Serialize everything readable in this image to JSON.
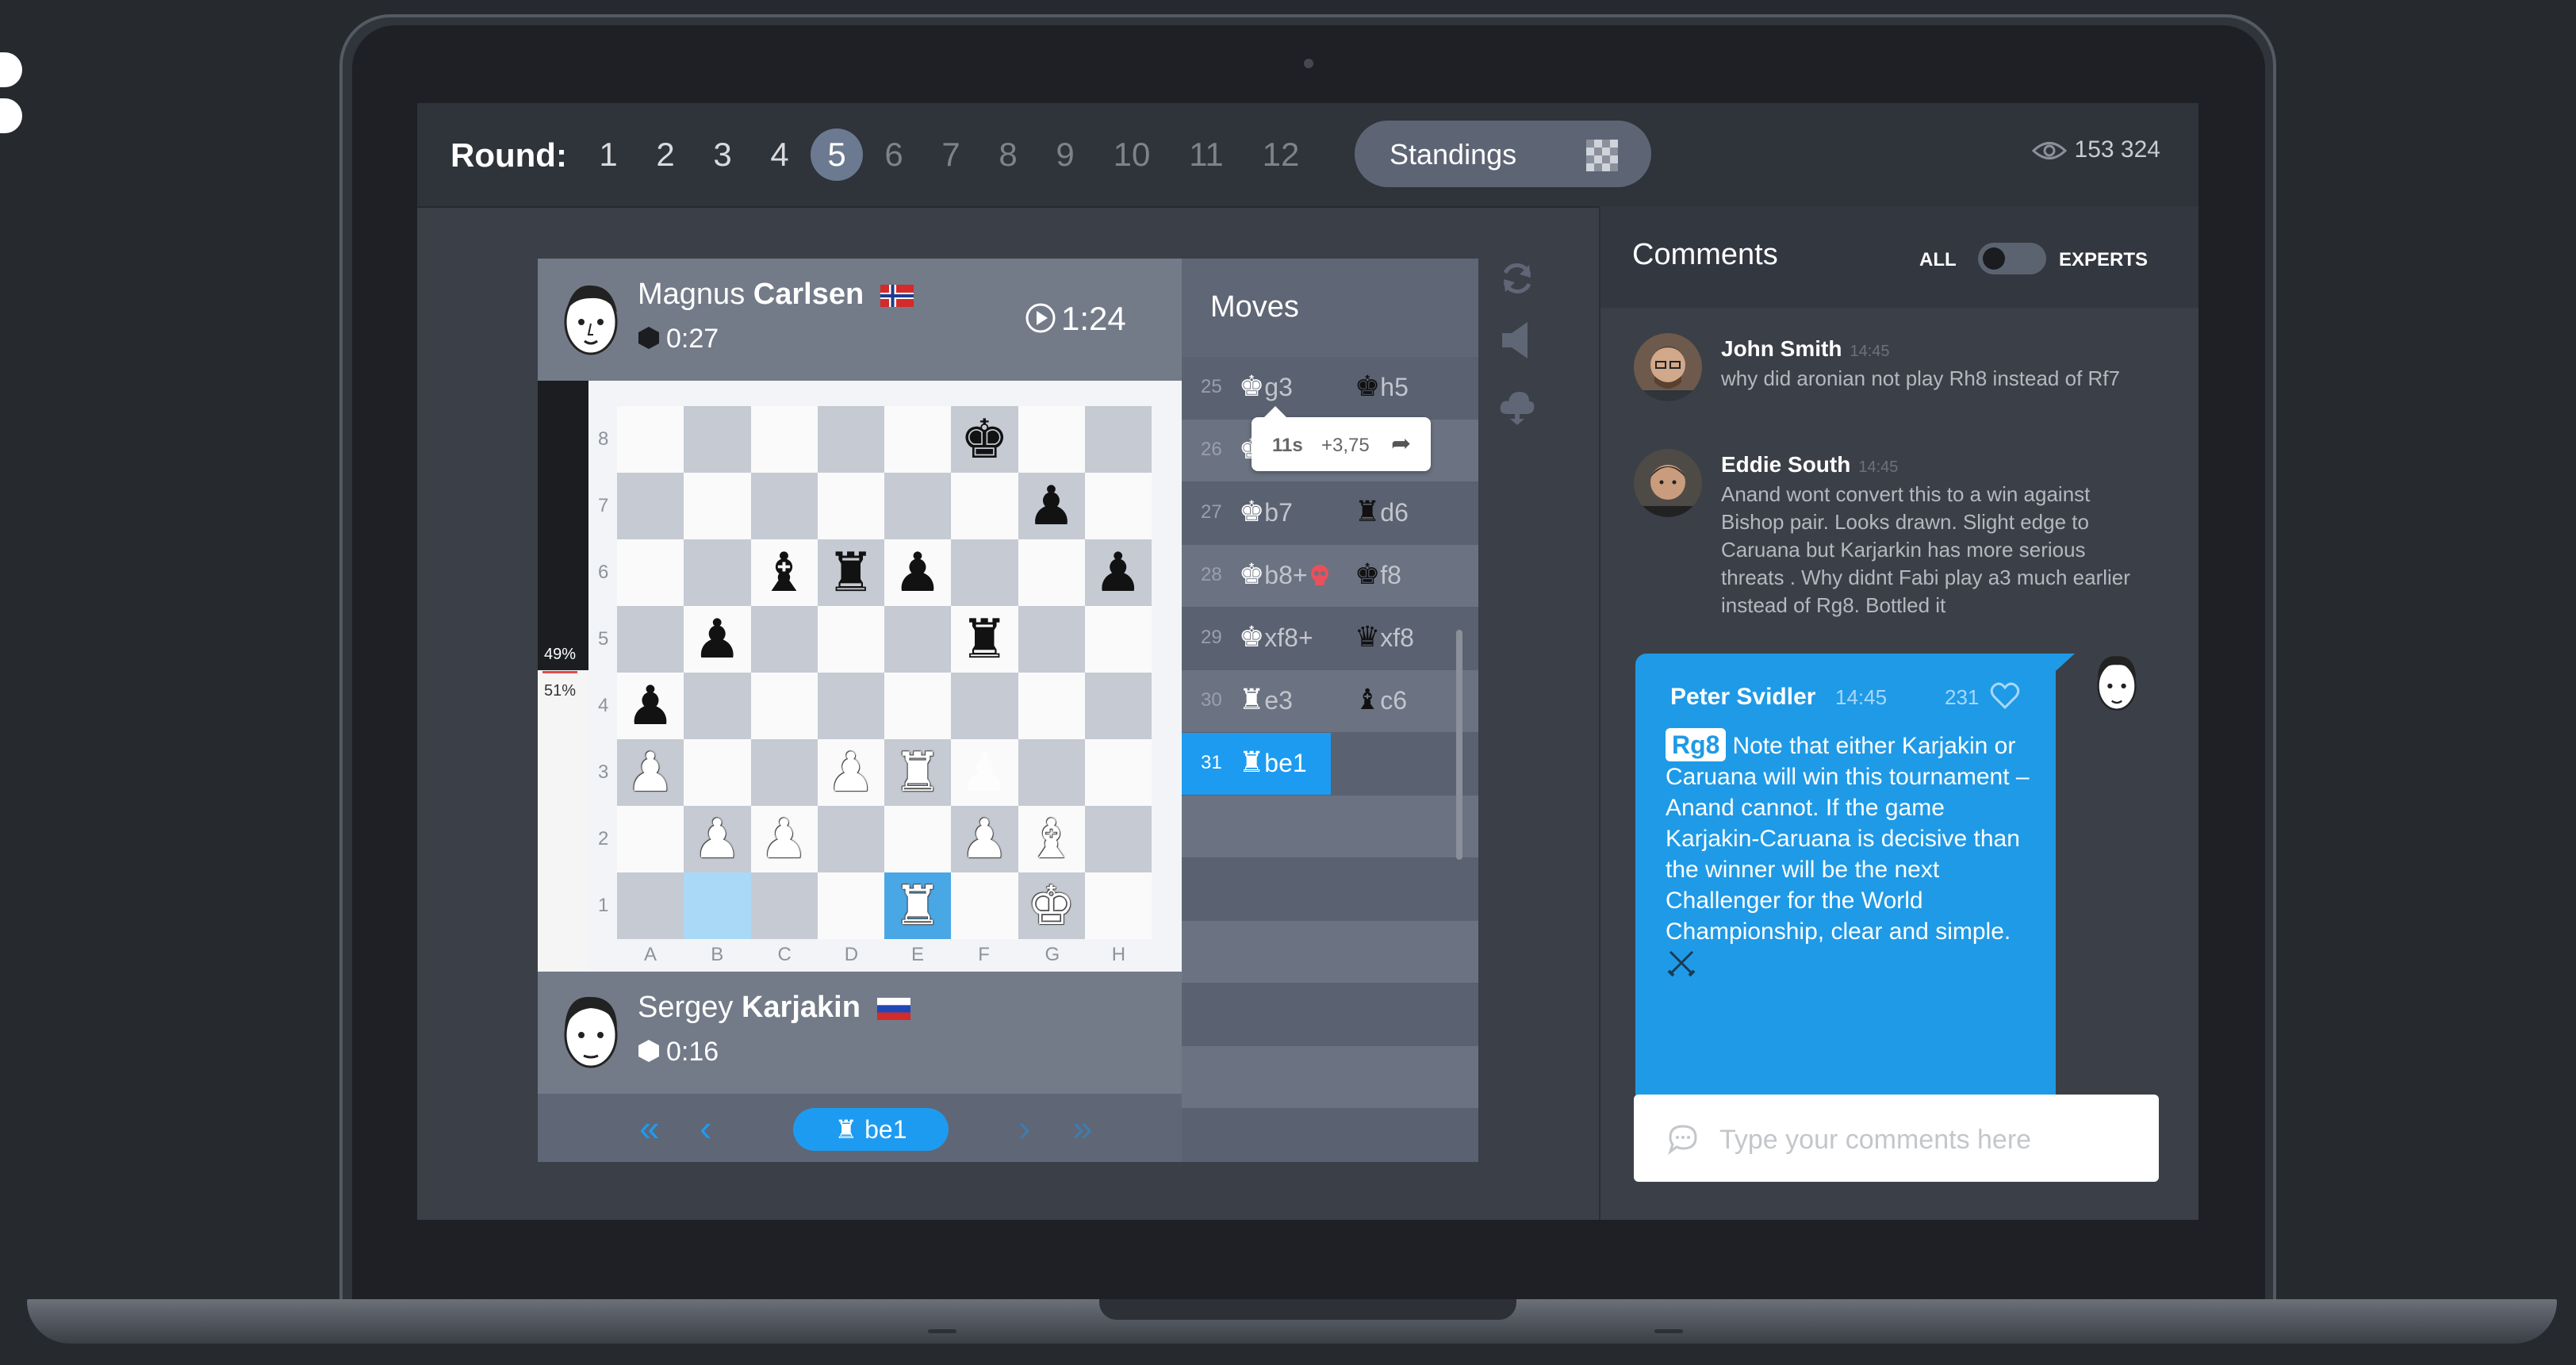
{
  "header": {
    "round_label": "Round:",
    "rounds": [
      "1",
      "2",
      "3",
      "4",
      "5",
      "6",
      "7",
      "8",
      "9",
      "10",
      "11",
      "12"
    ],
    "active_round": "5",
    "standings_label": "Standings",
    "viewers": "153 324"
  },
  "white_player": {
    "first_name": "Magnus",
    "last_name": "Carlsen",
    "time": "0:27",
    "clock": "1:24",
    "flag": "norway-flag-icon"
  },
  "black_player": {
    "first_name": "Sergey",
    "last_name": "Karjakin",
    "time": "0:16",
    "flag": "russia-flag-icon"
  },
  "eval": {
    "black_pct": "49%",
    "white_pct": "51%",
    "white_fraction": 0.51
  },
  "board": {
    "ranks": [
      "8",
      "7",
      "6",
      "5",
      "4",
      "3",
      "2",
      "1"
    ],
    "files": [
      "A",
      "B",
      "C",
      "D",
      "E",
      "F",
      "G",
      "H"
    ]
  },
  "moves_title": "Moves",
  "moves": [
    {
      "num": "25",
      "white": "g3",
      "white_piece": "♚",
      "black": "h5",
      "black_piece": "♚"
    },
    {
      "num": "26",
      "white": "",
      "white_piece": "♚",
      "black": "",
      "black_piece": ""
    },
    {
      "num": "27",
      "white": "b7",
      "white_piece": "♚",
      "black": "d6",
      "black_piece": "♜"
    },
    {
      "num": "28",
      "white": "b8+",
      "white_piece": "♚",
      "black": "f8",
      "black_piece": "♚"
    },
    {
      "num": "29",
      "white": "xf8+",
      "white_piece": "♚",
      "black": "xf8",
      "black_piece": "♛"
    },
    {
      "num": "30",
      "white": "e3",
      "white_piece": "♜",
      "black": "c6",
      "black_piece": "♝"
    },
    {
      "num": "31",
      "white": "be1",
      "white_piece": "♜",
      "black": "",
      "black_piece": ""
    }
  ],
  "tooltip": {
    "time": "11s",
    "score": "+3,75"
  },
  "nav": {
    "current_move": "be1"
  },
  "comments": {
    "title": "Comments",
    "filter_all": "ALL",
    "filter_experts": "EXPERTS",
    "items": [
      {
        "name": "John Smith",
        "time": "14:45",
        "text": "why did aronian not play Rh8 instead of Rf7"
      },
      {
        "name": "Eddie South",
        "time": "14:45",
        "text": "Anand wont convert this to a win against Bishop pair. Looks drawn. Slight edge to Caruana but Karjarkin has more serious threats . Why didnt Fabi play a3 much earlier instead of Rg8. Bottled it"
      }
    ],
    "expert": {
      "name": "Peter Svidler",
      "time": "14:45",
      "likes": "231",
      "tag": "Rg8",
      "text": "Note that either Karjakin or Caruana will win this tournament – Anand cannot. If the game Karjakin-Caruana is decisive than the winner will be the next Challenger for the World Championship, clear and simple."
    },
    "input_placeholder": "Type your comments here"
  },
  "colors": {
    "accent": "#1d9bf0",
    "background": "#26292e",
    "panel": "#3b3f47"
  }
}
